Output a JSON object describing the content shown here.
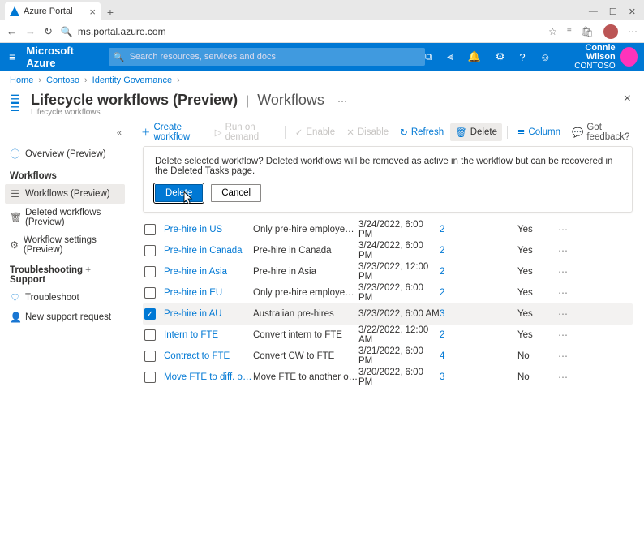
{
  "browser": {
    "tab_title": "Azure Portal",
    "url": "ms.portal.azure.com"
  },
  "azure_bar": {
    "brand": "Microsoft Azure",
    "search_placeholder": "Search resources, services and docs",
    "user_name": "Connie Wilson",
    "user_org": "CONTOSO"
  },
  "breadcrumbs": [
    "Home",
    "Contoso",
    "Identity Governance"
  ],
  "header": {
    "title": "Lifecycle workflows (Preview)",
    "section": "Workflows",
    "subtitle": "Lifecycle workflows"
  },
  "sidebar": {
    "overview": "Overview (Preview)",
    "workflows_head": "Workflows",
    "workflows": "Workflows (Preview)",
    "deleted": "Deleted workflows (Preview)",
    "settings": "Workflow settings (Preview)",
    "support_head": "Troubleshooting + Support",
    "troubleshoot": "Troubleshoot",
    "support_req": "New support request"
  },
  "toolbar": {
    "create": "Create workflow",
    "run": "Run on demand",
    "enable": "Enable",
    "disable": "Disable",
    "refresh": "Refresh",
    "delete": "Delete",
    "column": "Column",
    "feedback": "Got feedback?"
  },
  "dialog": {
    "message": "Delete selected workflow? Deleted workflows will be removed as active in the workflow but can be recovered in the Deleted Tasks page.",
    "confirm": "Delete",
    "cancel": "Cancel"
  },
  "rows": [
    {
      "name": "Pre-hire in US",
      "desc": "Only pre-hire employees in the USA",
      "date": "3/24/2022, 6:00 PM",
      "count": "2",
      "schedule": "Yes",
      "checked": false
    },
    {
      "name": "Pre-hire in Canada",
      "desc": "Pre-hire in Canada",
      "date": "3/24/2022, 6:00 PM",
      "count": "2",
      "schedule": "Yes",
      "checked": false
    },
    {
      "name": "Pre-hire in Asia",
      "desc": "Pre-hire in Asia",
      "date": "3/23/2022, 12:00 PM",
      "count": "2",
      "schedule": "Yes",
      "checked": false
    },
    {
      "name": "Pre-hire in EU",
      "desc": "Only pre-hire employees in Europe…",
      "date": "3/23/2022, 6:00 PM",
      "count": "2",
      "schedule": "Yes",
      "checked": false
    },
    {
      "name": "Pre-hire in AU",
      "desc": "Australian pre-hires",
      "date": "3/23/2022, 6:00 AM",
      "count": "3",
      "schedule": "Yes",
      "checked": true
    },
    {
      "name": "Intern to FTE",
      "desc": "Convert intern to FTE",
      "date": "3/22/2022, 12:00 AM",
      "count": "2",
      "schedule": "Yes",
      "checked": false
    },
    {
      "name": "Contract to FTE",
      "desc": "Convert CW to FTE",
      "date": "3/21/2022, 6:00 PM",
      "count": "4",
      "schedule": "No",
      "checked": false
    },
    {
      "name": "Move FTE to diff. org.",
      "desc": "Move FTE to another organization",
      "date": "3/20/2022, 6:00 PM",
      "count": "3",
      "schedule": "No",
      "checked": false
    }
  ]
}
